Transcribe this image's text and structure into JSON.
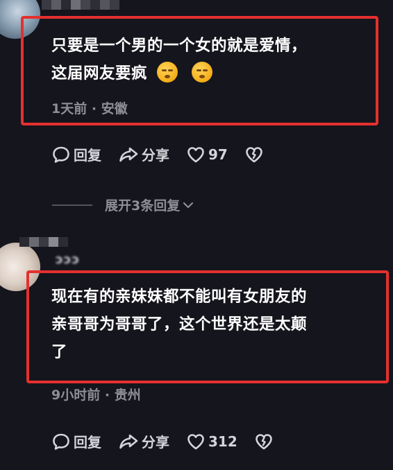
{
  "comments": [
    {
      "text_line1": "只要是一个男的一个女的就是爱情，",
      "text_line2": "这届网友要疯",
      "emojis": [
        "smirk-emoji",
        "smirk-emoji"
      ],
      "time": "1天前",
      "separator": "·",
      "location": "安徽",
      "reply_label": "回复",
      "share_label": "分享",
      "likes": "97",
      "highlight_color": "#e5302e"
    },
    {
      "username": "ɔɔɔ",
      "text_line1": "现在有的亲妹妹都不能叫有女朋友的",
      "text_line2": "亲哥哥为哥哥了，这个世界还是太颠",
      "text_line3": "了",
      "time": "9小时前",
      "separator": "·",
      "location": "贵州",
      "reply_label": "回复",
      "share_label": "分享",
      "likes": "312",
      "highlight_color": "#e5302e"
    }
  ],
  "expand_replies": {
    "label": "展开3条回复"
  },
  "colors": {
    "background": "#15151d",
    "text": "#ffffff",
    "muted": "#8e8e96",
    "highlight": "#e5302e"
  }
}
